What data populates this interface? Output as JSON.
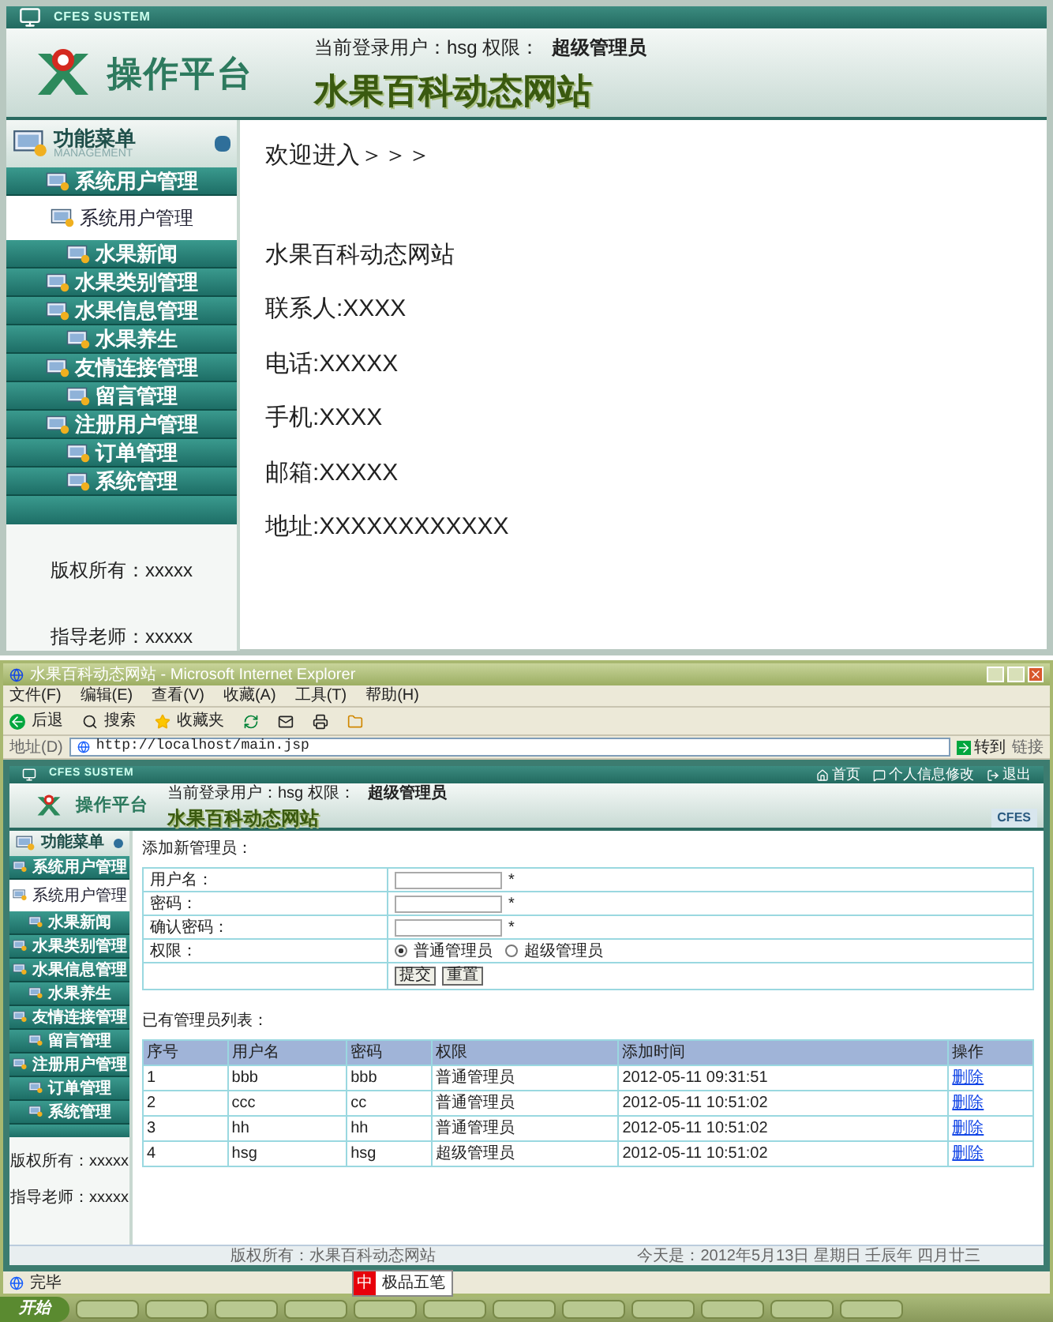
{
  "top": {
    "system_label": "CFES SUSTEM",
    "brand": "操作平台",
    "user_label": "当前登录用户：hsg 权限：",
    "role": "超级管理员",
    "site_title": "水果百科动态网站",
    "menu_title": "功能菜单",
    "menu_subtitle": "MANAGEMENT",
    "menu": [
      {
        "label": "系统用户管理",
        "kind": "header",
        "selected": false
      },
      {
        "label": "系统用户管理",
        "kind": "sub",
        "selected": true
      },
      {
        "label": "水果新闻",
        "kind": "header",
        "selected": false
      },
      {
        "label": "水果类别管理",
        "kind": "header",
        "selected": false
      },
      {
        "label": "水果信息管理",
        "kind": "header",
        "selected": false
      },
      {
        "label": "水果养生",
        "kind": "header",
        "selected": false
      },
      {
        "label": "友情连接管理",
        "kind": "header",
        "selected": false
      },
      {
        "label": "留言管理",
        "kind": "header",
        "selected": false
      },
      {
        "label": "注册用户管理",
        "kind": "header",
        "selected": false
      },
      {
        "label": "订单管理",
        "kind": "header",
        "selected": false
      },
      {
        "label": "系统管理",
        "kind": "header",
        "selected": false
      }
    ],
    "footer": [
      "版权所有：xxxxx",
      "指导老师：xxxxx"
    ],
    "welcome": "欢迎进入＞＞＞",
    "info": [
      "水果百科动态网站",
      "联系人:XXXX",
      "电话:XXXXX",
      "手机:XXXX",
      "邮箱:XXXXX",
      "地址:XXXXXXXXXXXX"
    ]
  },
  "browser": {
    "title": "水果百科动态网站 - Microsoft Internet Explorer",
    "menus": [
      "文件(F)",
      "编辑(E)",
      "查看(V)",
      "收藏(A)",
      "工具(T)",
      "帮助(H)"
    ],
    "toolbar": [
      {
        "label": "后退",
        "kind": "back"
      },
      {
        "label": "搜索",
        "kind": "search"
      },
      {
        "label": "收藏夹",
        "kind": "favorites"
      }
    ],
    "address_label": "地址(D)",
    "url": "http://localhost/main.jsp",
    "go": "转到",
    "links": "链接",
    "page": {
      "system_label": "CFES SUSTEM",
      "brand": "操作平台",
      "user_label": "当前登录用户：hsg 权限：",
      "role": "超级管理员",
      "site_title": "水果百科动态网站",
      "top_links": [
        "首页",
        "个人信息修改",
        "退出"
      ],
      "corner": "CFES",
      "menu_title": "功能菜单",
      "menu": [
        {
          "label": "系统用户管理",
          "kind": "header",
          "selected": false
        },
        {
          "label": "系统用户管理",
          "kind": "sub",
          "selected": true
        },
        {
          "label": "水果新闻",
          "kind": "header",
          "selected": false
        },
        {
          "label": "水果类别管理",
          "kind": "header",
          "selected": false
        },
        {
          "label": "水果信息管理",
          "kind": "header",
          "selected": false
        },
        {
          "label": "水果养生",
          "kind": "header",
          "selected": false
        },
        {
          "label": "友情连接管理",
          "kind": "header",
          "selected": false
        },
        {
          "label": "留言管理",
          "kind": "header",
          "selected": false
        },
        {
          "label": "注册用户管理",
          "kind": "header",
          "selected": false
        },
        {
          "label": "订单管理",
          "kind": "header",
          "selected": false
        },
        {
          "label": "系统管理",
          "kind": "header",
          "selected": false
        }
      ],
      "footer": [
        "版权所有：xxxxx",
        "指导老师：xxxxx"
      ],
      "form_title": "添加新管理员：",
      "fields": [
        {
          "label": "用户名：",
          "mark": "*"
        },
        {
          "label": "密码：",
          "mark": "*"
        },
        {
          "label": "确认密码：",
          "mark": "*"
        }
      ],
      "role_label": "权限：",
      "roles": [
        {
          "label": "普通管理员",
          "selected": true
        },
        {
          "label": "超级管理员",
          "selected": false
        }
      ],
      "buttons": [
        "提交",
        "重置"
      ],
      "list_title": "已有管理员列表：",
      "columns": [
        "序号",
        "用户名",
        "密码",
        "权限",
        "添加时间",
        "操作"
      ],
      "rows": [
        [
          "1",
          "bbb",
          "bbb",
          "普通管理员",
          "2012-05-11 09:31:51",
          "删除"
        ],
        [
          "2",
          "ccc",
          "cc",
          "普通管理员",
          "2012-05-11 10:51:02",
          "删除"
        ],
        [
          "3",
          "hh",
          "hh",
          "普通管理员",
          "2012-05-11 10:51:02",
          "删除"
        ],
        [
          "4",
          "hsg",
          "hsg",
          "超级管理员",
          "2012-05-11 10:51:02",
          "删除"
        ]
      ],
      "copyright": "版权所有：水果百科动态网站",
      "today": "今天是：2012年5月13日 星期日 壬辰年 四月廿三"
    },
    "status": "完毕"
  },
  "taskbar": {
    "start": "开始",
    "ime": "中",
    "ime_name": "极品五笔"
  }
}
